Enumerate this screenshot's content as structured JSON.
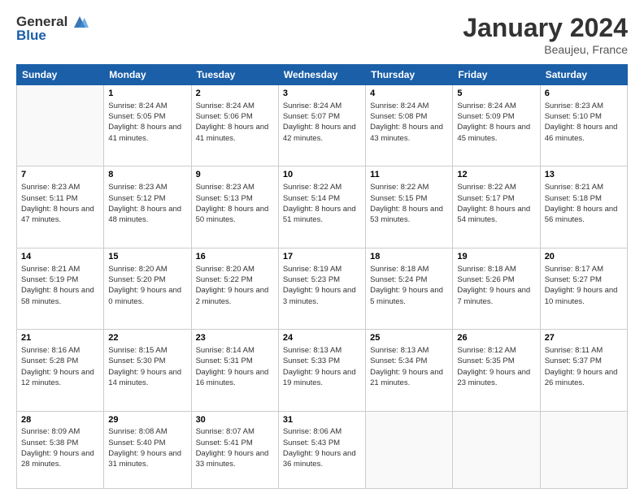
{
  "logo": {
    "general": "General",
    "blue": "Blue"
  },
  "title": "January 2024",
  "subtitle": "Beaujeu, France",
  "headers": [
    "Sunday",
    "Monday",
    "Tuesday",
    "Wednesday",
    "Thursday",
    "Friday",
    "Saturday"
  ],
  "weeks": [
    [
      {
        "day": "",
        "sunrise": "",
        "sunset": "",
        "daylight": ""
      },
      {
        "day": "1",
        "sunrise": "Sunrise: 8:24 AM",
        "sunset": "Sunset: 5:05 PM",
        "daylight": "Daylight: 8 hours and 41 minutes."
      },
      {
        "day": "2",
        "sunrise": "Sunrise: 8:24 AM",
        "sunset": "Sunset: 5:06 PM",
        "daylight": "Daylight: 8 hours and 41 minutes."
      },
      {
        "day": "3",
        "sunrise": "Sunrise: 8:24 AM",
        "sunset": "Sunset: 5:07 PM",
        "daylight": "Daylight: 8 hours and 42 minutes."
      },
      {
        "day": "4",
        "sunrise": "Sunrise: 8:24 AM",
        "sunset": "Sunset: 5:08 PM",
        "daylight": "Daylight: 8 hours and 43 minutes."
      },
      {
        "day": "5",
        "sunrise": "Sunrise: 8:24 AM",
        "sunset": "Sunset: 5:09 PM",
        "daylight": "Daylight: 8 hours and 45 minutes."
      },
      {
        "day": "6",
        "sunrise": "Sunrise: 8:23 AM",
        "sunset": "Sunset: 5:10 PM",
        "daylight": "Daylight: 8 hours and 46 minutes."
      }
    ],
    [
      {
        "day": "7",
        "sunrise": "Sunrise: 8:23 AM",
        "sunset": "Sunset: 5:11 PM",
        "daylight": "Daylight: 8 hours and 47 minutes."
      },
      {
        "day": "8",
        "sunrise": "Sunrise: 8:23 AM",
        "sunset": "Sunset: 5:12 PM",
        "daylight": "Daylight: 8 hours and 48 minutes."
      },
      {
        "day": "9",
        "sunrise": "Sunrise: 8:23 AM",
        "sunset": "Sunset: 5:13 PM",
        "daylight": "Daylight: 8 hours and 50 minutes."
      },
      {
        "day": "10",
        "sunrise": "Sunrise: 8:22 AM",
        "sunset": "Sunset: 5:14 PM",
        "daylight": "Daylight: 8 hours and 51 minutes."
      },
      {
        "day": "11",
        "sunrise": "Sunrise: 8:22 AM",
        "sunset": "Sunset: 5:15 PM",
        "daylight": "Daylight: 8 hours and 53 minutes."
      },
      {
        "day": "12",
        "sunrise": "Sunrise: 8:22 AM",
        "sunset": "Sunset: 5:17 PM",
        "daylight": "Daylight: 8 hours and 54 minutes."
      },
      {
        "day": "13",
        "sunrise": "Sunrise: 8:21 AM",
        "sunset": "Sunset: 5:18 PM",
        "daylight": "Daylight: 8 hours and 56 minutes."
      }
    ],
    [
      {
        "day": "14",
        "sunrise": "Sunrise: 8:21 AM",
        "sunset": "Sunset: 5:19 PM",
        "daylight": "Daylight: 8 hours and 58 minutes."
      },
      {
        "day": "15",
        "sunrise": "Sunrise: 8:20 AM",
        "sunset": "Sunset: 5:20 PM",
        "daylight": "Daylight: 9 hours and 0 minutes."
      },
      {
        "day": "16",
        "sunrise": "Sunrise: 8:20 AM",
        "sunset": "Sunset: 5:22 PM",
        "daylight": "Daylight: 9 hours and 2 minutes."
      },
      {
        "day": "17",
        "sunrise": "Sunrise: 8:19 AM",
        "sunset": "Sunset: 5:23 PM",
        "daylight": "Daylight: 9 hours and 3 minutes."
      },
      {
        "day": "18",
        "sunrise": "Sunrise: 8:18 AM",
        "sunset": "Sunset: 5:24 PM",
        "daylight": "Daylight: 9 hours and 5 minutes."
      },
      {
        "day": "19",
        "sunrise": "Sunrise: 8:18 AM",
        "sunset": "Sunset: 5:26 PM",
        "daylight": "Daylight: 9 hours and 7 minutes."
      },
      {
        "day": "20",
        "sunrise": "Sunrise: 8:17 AM",
        "sunset": "Sunset: 5:27 PM",
        "daylight": "Daylight: 9 hours and 10 minutes."
      }
    ],
    [
      {
        "day": "21",
        "sunrise": "Sunrise: 8:16 AM",
        "sunset": "Sunset: 5:28 PM",
        "daylight": "Daylight: 9 hours and 12 minutes."
      },
      {
        "day": "22",
        "sunrise": "Sunrise: 8:15 AM",
        "sunset": "Sunset: 5:30 PM",
        "daylight": "Daylight: 9 hours and 14 minutes."
      },
      {
        "day": "23",
        "sunrise": "Sunrise: 8:14 AM",
        "sunset": "Sunset: 5:31 PM",
        "daylight": "Daylight: 9 hours and 16 minutes."
      },
      {
        "day": "24",
        "sunrise": "Sunrise: 8:13 AM",
        "sunset": "Sunset: 5:33 PM",
        "daylight": "Daylight: 9 hours and 19 minutes."
      },
      {
        "day": "25",
        "sunrise": "Sunrise: 8:13 AM",
        "sunset": "Sunset: 5:34 PM",
        "daylight": "Daylight: 9 hours and 21 minutes."
      },
      {
        "day": "26",
        "sunrise": "Sunrise: 8:12 AM",
        "sunset": "Sunset: 5:35 PM",
        "daylight": "Daylight: 9 hours and 23 minutes."
      },
      {
        "day": "27",
        "sunrise": "Sunrise: 8:11 AM",
        "sunset": "Sunset: 5:37 PM",
        "daylight": "Daylight: 9 hours and 26 minutes."
      }
    ],
    [
      {
        "day": "28",
        "sunrise": "Sunrise: 8:09 AM",
        "sunset": "Sunset: 5:38 PM",
        "daylight": "Daylight: 9 hours and 28 minutes."
      },
      {
        "day": "29",
        "sunrise": "Sunrise: 8:08 AM",
        "sunset": "Sunset: 5:40 PM",
        "daylight": "Daylight: 9 hours and 31 minutes."
      },
      {
        "day": "30",
        "sunrise": "Sunrise: 8:07 AM",
        "sunset": "Sunset: 5:41 PM",
        "daylight": "Daylight: 9 hours and 33 minutes."
      },
      {
        "day": "31",
        "sunrise": "Sunrise: 8:06 AM",
        "sunset": "Sunset: 5:43 PM",
        "daylight": "Daylight: 9 hours and 36 minutes."
      },
      {
        "day": "",
        "sunrise": "",
        "sunset": "",
        "daylight": ""
      },
      {
        "day": "",
        "sunrise": "",
        "sunset": "",
        "daylight": ""
      },
      {
        "day": "",
        "sunrise": "",
        "sunset": "",
        "daylight": ""
      }
    ]
  ]
}
